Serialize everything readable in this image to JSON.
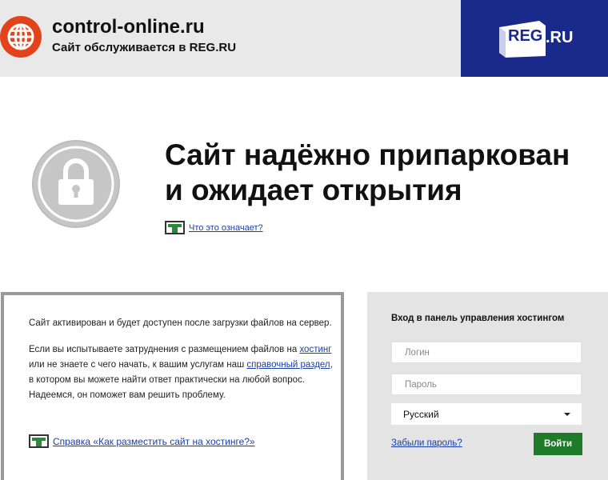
{
  "header": {
    "domain": "control-online.ru",
    "hosted_text": "Сайт обслуживается в REG.RU",
    "brand": {
      "reg": "REG",
      "ru": ".RU",
      "color": "#1a2a8a"
    }
  },
  "parked": {
    "headline_line1": "Сайт надёжно припаркован",
    "headline_line2": "и ожидает открытия",
    "meaning_link": "Что это означает?"
  },
  "info": {
    "para1": "Сайт активирован и будет доступен после загрузки файлов на сервер.",
    "para2_part1": "Если вы испытываете затруднения с размещением файлов на ",
    "hosting_link": "хостинг",
    "para2_part2": " или не знаете с чего начать, к вашим услугам наш ",
    "help_section_link": "справочный раздел",
    "para2_part3": ", в котором вы можете найти ответ практически на любой вопрос. Надеемся, он поможет вам решить проблему.",
    "help_link": "Справка «Как разместить сайт на хостинге?»"
  },
  "login": {
    "title": "Вход в панель управления хостингом",
    "login_placeholder": "Логин",
    "password_placeholder": "Пароль",
    "language": "Русский",
    "forgot": "Забыли пароль?",
    "submit": "Войти"
  },
  "colors": {
    "accent_button": "#1f7a2a",
    "link": "#1a3ea8",
    "globe": "#e3431b"
  }
}
